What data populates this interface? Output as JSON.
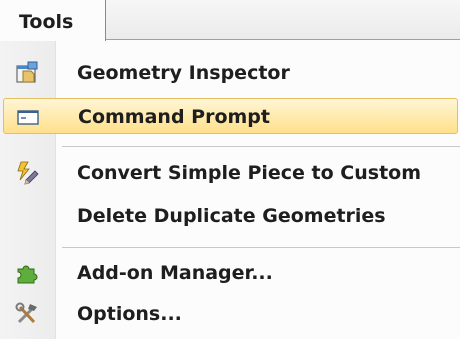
{
  "menu": {
    "title": "Tools",
    "items": [
      {
        "label": "Geometry Inspector",
        "icon": "inspector-icon",
        "highlighted": false
      },
      {
        "label": "Command Prompt",
        "icon": "console-icon",
        "highlighted": true
      },
      {
        "label": "Convert Simple Piece to Custom",
        "icon": "convert-pencil-icon",
        "highlighted": false
      },
      {
        "label": "Delete Duplicate Geometries",
        "icon": "",
        "highlighted": false
      },
      {
        "label": "Add-on Manager...",
        "icon": "puzzle-piece-icon",
        "highlighted": false
      },
      {
        "label": "Options...",
        "icon": "tools-icon",
        "highlighted": false
      }
    ]
  },
  "colors": {
    "highlight_top": "#fff6d6",
    "highlight_bottom": "#ffe08a",
    "highlight_border": "#e6bf62",
    "text": "#1e1e1e"
  }
}
